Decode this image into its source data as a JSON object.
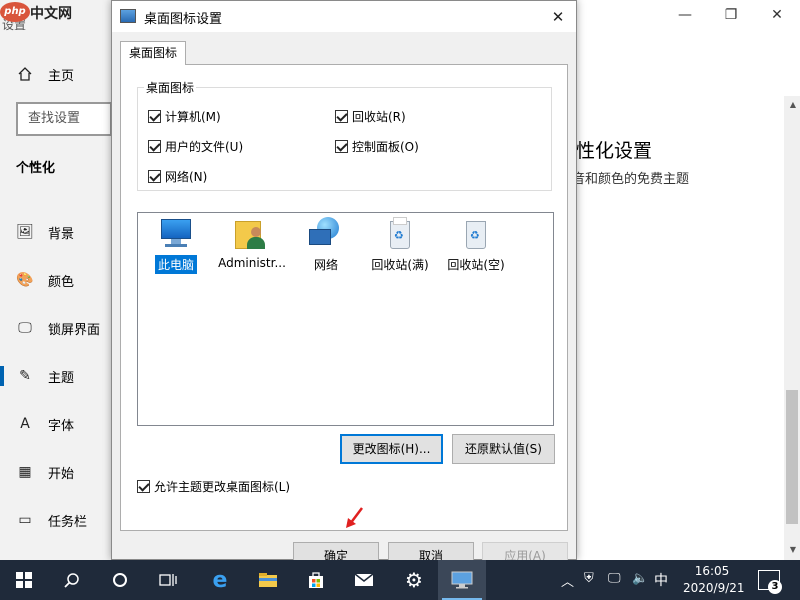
{
  "watermark": {
    "logo": "php",
    "text": "中文网",
    "under": "设置"
  },
  "settings": {
    "home": "主页",
    "search_placeholder": "查找设置",
    "section": "个性化",
    "nav": [
      {
        "icon": "🖼",
        "label": "背景"
      },
      {
        "icon": "🎨",
        "label": "颜色"
      },
      {
        "icon": "🖵",
        "label": "锁屏界面"
      },
      {
        "icon": "✎",
        "label": "主题"
      },
      {
        "icon": "A",
        "label": "字体"
      },
      {
        "icon": "▦",
        "label": "开始"
      },
      {
        "icon": "▭",
        "label": "任务栏"
      }
    ],
    "right_heading": "性化设置",
    "right_sub": "音和颜色的免费主题"
  },
  "dialog": {
    "title": "桌面图标设置",
    "tab": "桌面图标",
    "group_label": "桌面图标",
    "checkboxes": {
      "computer": "计算机(M)",
      "recycle": "回收站(R)",
      "userfiles": "用户的文件(U)",
      "control": "控制面板(O)",
      "network": "网络(N)"
    },
    "icons": {
      "pc": "此电脑",
      "admin": "Administr...",
      "net": "网络",
      "bin_full": "回收站(满)",
      "bin_empty": "回收站(空)"
    },
    "change_icon": "更改图标(H)...",
    "restore_default": "还原默认值(S)",
    "allow_theme": "允许主题更改桌面图标(L)",
    "ok": "确定",
    "cancel": "取消",
    "apply": "应用(A)"
  },
  "taskbar": {
    "time": "16:05",
    "date": "2020/9/21",
    "ime": "中",
    "notifications": "3"
  },
  "colors": {
    "accent": "#0078d7",
    "taskbar": "#1f2a3a",
    "arrow": "#e02020"
  }
}
